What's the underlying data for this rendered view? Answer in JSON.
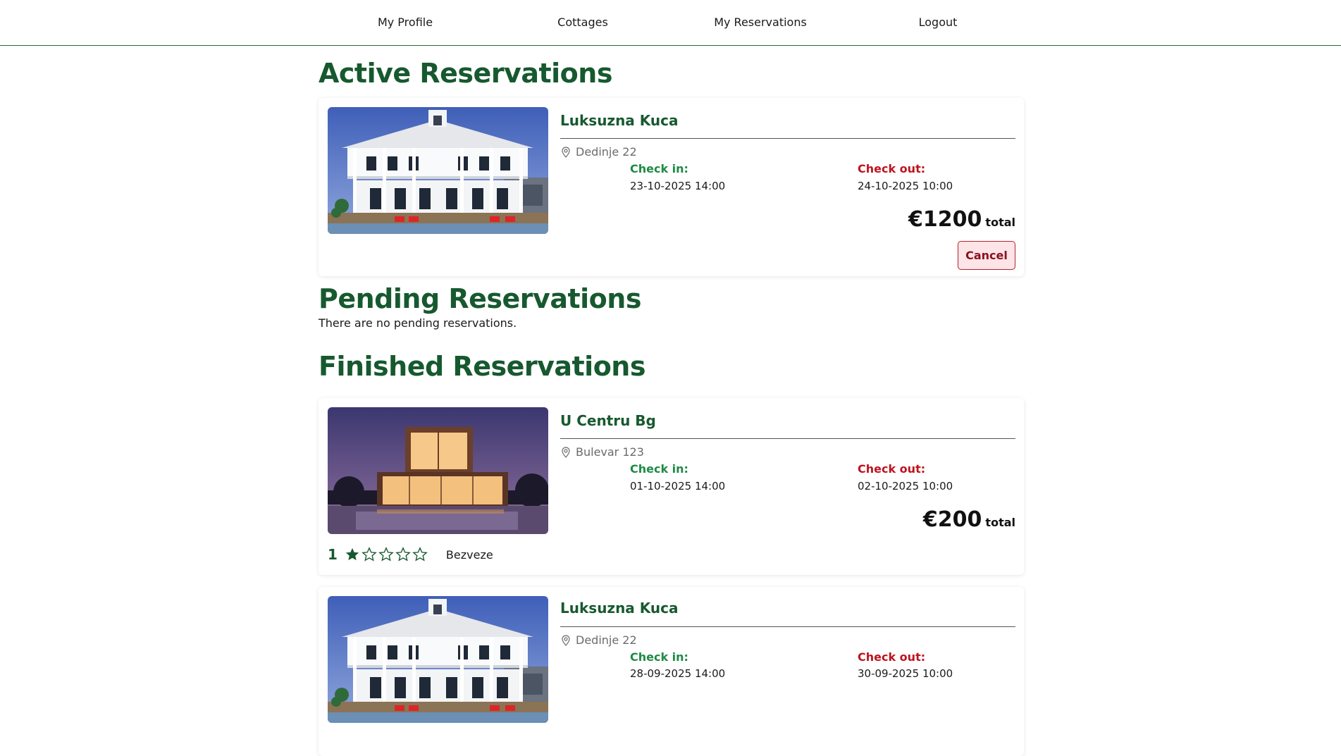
{
  "nav": {
    "items": [
      "My Profile",
      "Cottages",
      "My Reservations",
      "Logout"
    ]
  },
  "sections": {
    "active_title": "Active Reservations",
    "pending_title": "Pending Reservations",
    "pending_empty": "There are no pending reservations.",
    "finished_title": "Finished Reservations"
  },
  "labels": {
    "check_in": "Check in:",
    "check_out": "Check out:",
    "total": "total",
    "cancel": "Cancel"
  },
  "active": [
    {
      "name": "Luksuzna Kuca",
      "address": "Dedinje 22",
      "check_in": "23-10-2025 14:00",
      "check_out": "24-10-2025 10:00",
      "price": "€1200",
      "image": "white-villa-photo"
    }
  ],
  "finished": [
    {
      "name": "U Centru Bg",
      "address": "Bulevar 123",
      "check_in": "01-10-2025 14:00",
      "check_out": "02-10-2025 10:00",
      "price": "€200",
      "image": "modern-house-night-photo",
      "rating": 1,
      "rating_max": 5,
      "comment": "Bezveze"
    },
    {
      "name": "Luksuzna Kuca",
      "address": "Dedinje 22",
      "check_in": "28-09-2025 14:00",
      "check_out": "30-09-2025 10:00",
      "image": "white-villa-photo"
    }
  ],
  "colors": {
    "brand_green": "#17592f",
    "check_in_green": "#1e8a45",
    "check_out_red": "#c0121e",
    "cancel_bg": "#fde4e6"
  }
}
